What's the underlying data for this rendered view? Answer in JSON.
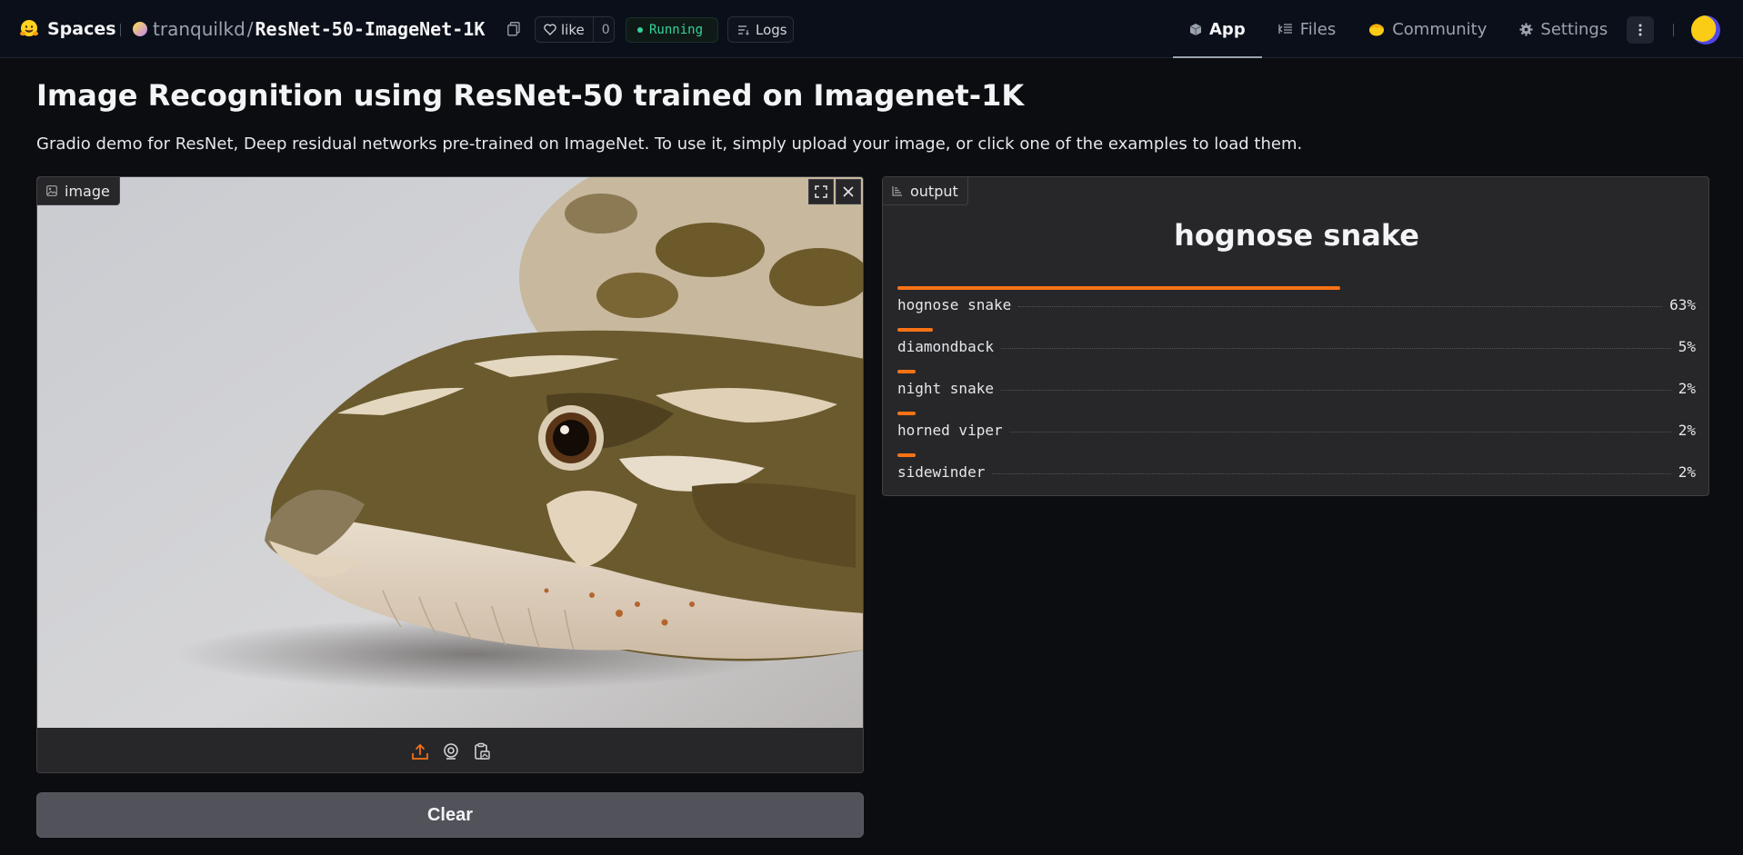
{
  "topbar": {
    "spaces_label": "Spaces",
    "owner": "tranquilkd",
    "slash": "/",
    "repo_name": "ResNet-50-ImageNet-1K",
    "like_label": "like",
    "like_count": "0",
    "status": "Running",
    "logs_label": "Logs",
    "tabs": [
      {
        "label": "App",
        "icon": "cube-icon"
      },
      {
        "label": "Files",
        "icon": "files-icon"
      },
      {
        "label": "Community",
        "icon": "community-icon"
      },
      {
        "label": "Settings",
        "icon": "gear-icon"
      }
    ],
    "active_tab": "App"
  },
  "page": {
    "title": "Image Recognition using ResNet-50 trained on Imagenet-1K",
    "description": "Gradio demo for ResNet, Deep residual networks pre-trained on ImageNet. To use it, simply upload your image, or click one of the examples to load them."
  },
  "input": {
    "label": "image",
    "image_subject": "hognose snake close-up",
    "sources": [
      "upload-icon",
      "webcam-icon",
      "clipboard-icon"
    ],
    "clear_label": "Clear"
  },
  "output": {
    "label": "output",
    "top_label": "hognose snake",
    "confidences": [
      {
        "label": "hognose snake",
        "pct": "63%",
        "value": 0.63
      },
      {
        "label": "diamondback",
        "pct": "5%",
        "value": 0.05
      },
      {
        "label": "night snake",
        "pct": "2%",
        "value": 0.02
      },
      {
        "label": "horned viper",
        "pct": "2%",
        "value": 0.02
      },
      {
        "label": "sidewinder",
        "pct": "2%",
        "value": 0.02
      }
    ]
  },
  "colors": {
    "accent": "#f97316",
    "running": "#34d399",
    "panel": "#27272a",
    "background": "#0c0d10"
  }
}
